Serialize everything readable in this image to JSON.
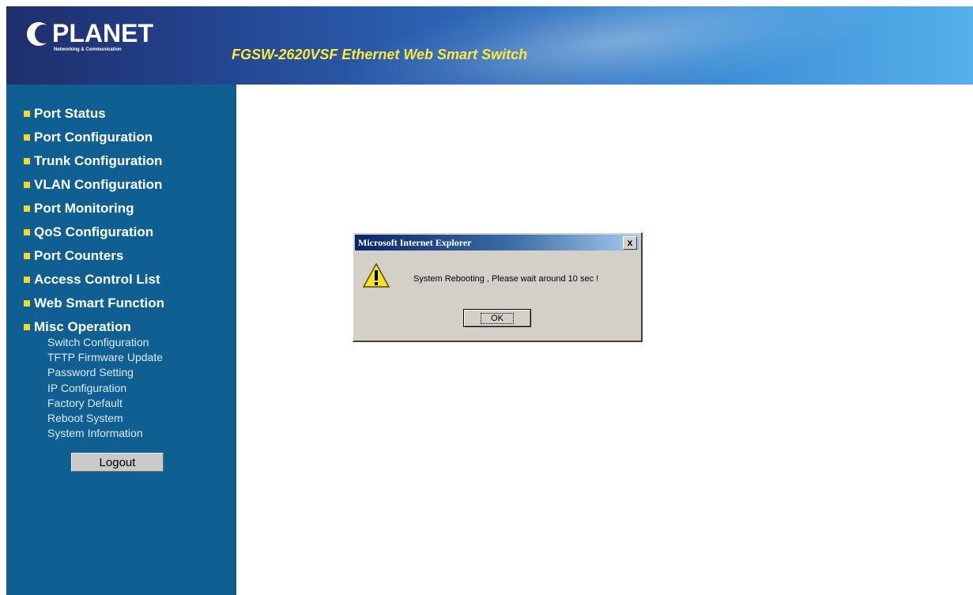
{
  "header": {
    "brand": "PLANET",
    "brand_sub": "Networking & Communication",
    "product_title": "FGSW-2620VSF Ethernet Web Smart Switch"
  },
  "sidebar": {
    "items": [
      {
        "label": "Port Status"
      },
      {
        "label": "Port Configuration"
      },
      {
        "label": "Trunk Configuration"
      },
      {
        "label": "VLAN Configuration"
      },
      {
        "label": "Port Monitoring"
      },
      {
        "label": "QoS Configuration"
      },
      {
        "label": "Port Counters"
      },
      {
        "label": "Access Control List"
      },
      {
        "label": "Web Smart Function"
      },
      {
        "label": "Misc Operation"
      }
    ],
    "subitems": [
      {
        "label": "Switch Configuration"
      },
      {
        "label": "TFTP Firmware Update"
      },
      {
        "label": "Password Setting"
      },
      {
        "label": "IP Configuration"
      },
      {
        "label": "Factory Default"
      },
      {
        "label": "Reboot System"
      },
      {
        "label": "System Information"
      }
    ],
    "logout_label": "Logout"
  },
  "dialog": {
    "title": "Microsoft Internet Explorer",
    "close_glyph": "x",
    "message": "System Rebooting , Please wait around 10 sec !",
    "ok_label": "OK",
    "icon": "warning-icon"
  },
  "colors": {
    "sidebar_bg": "#0f5f93",
    "bullet": "#f3d531",
    "title_yellow": "#ffe93a"
  }
}
